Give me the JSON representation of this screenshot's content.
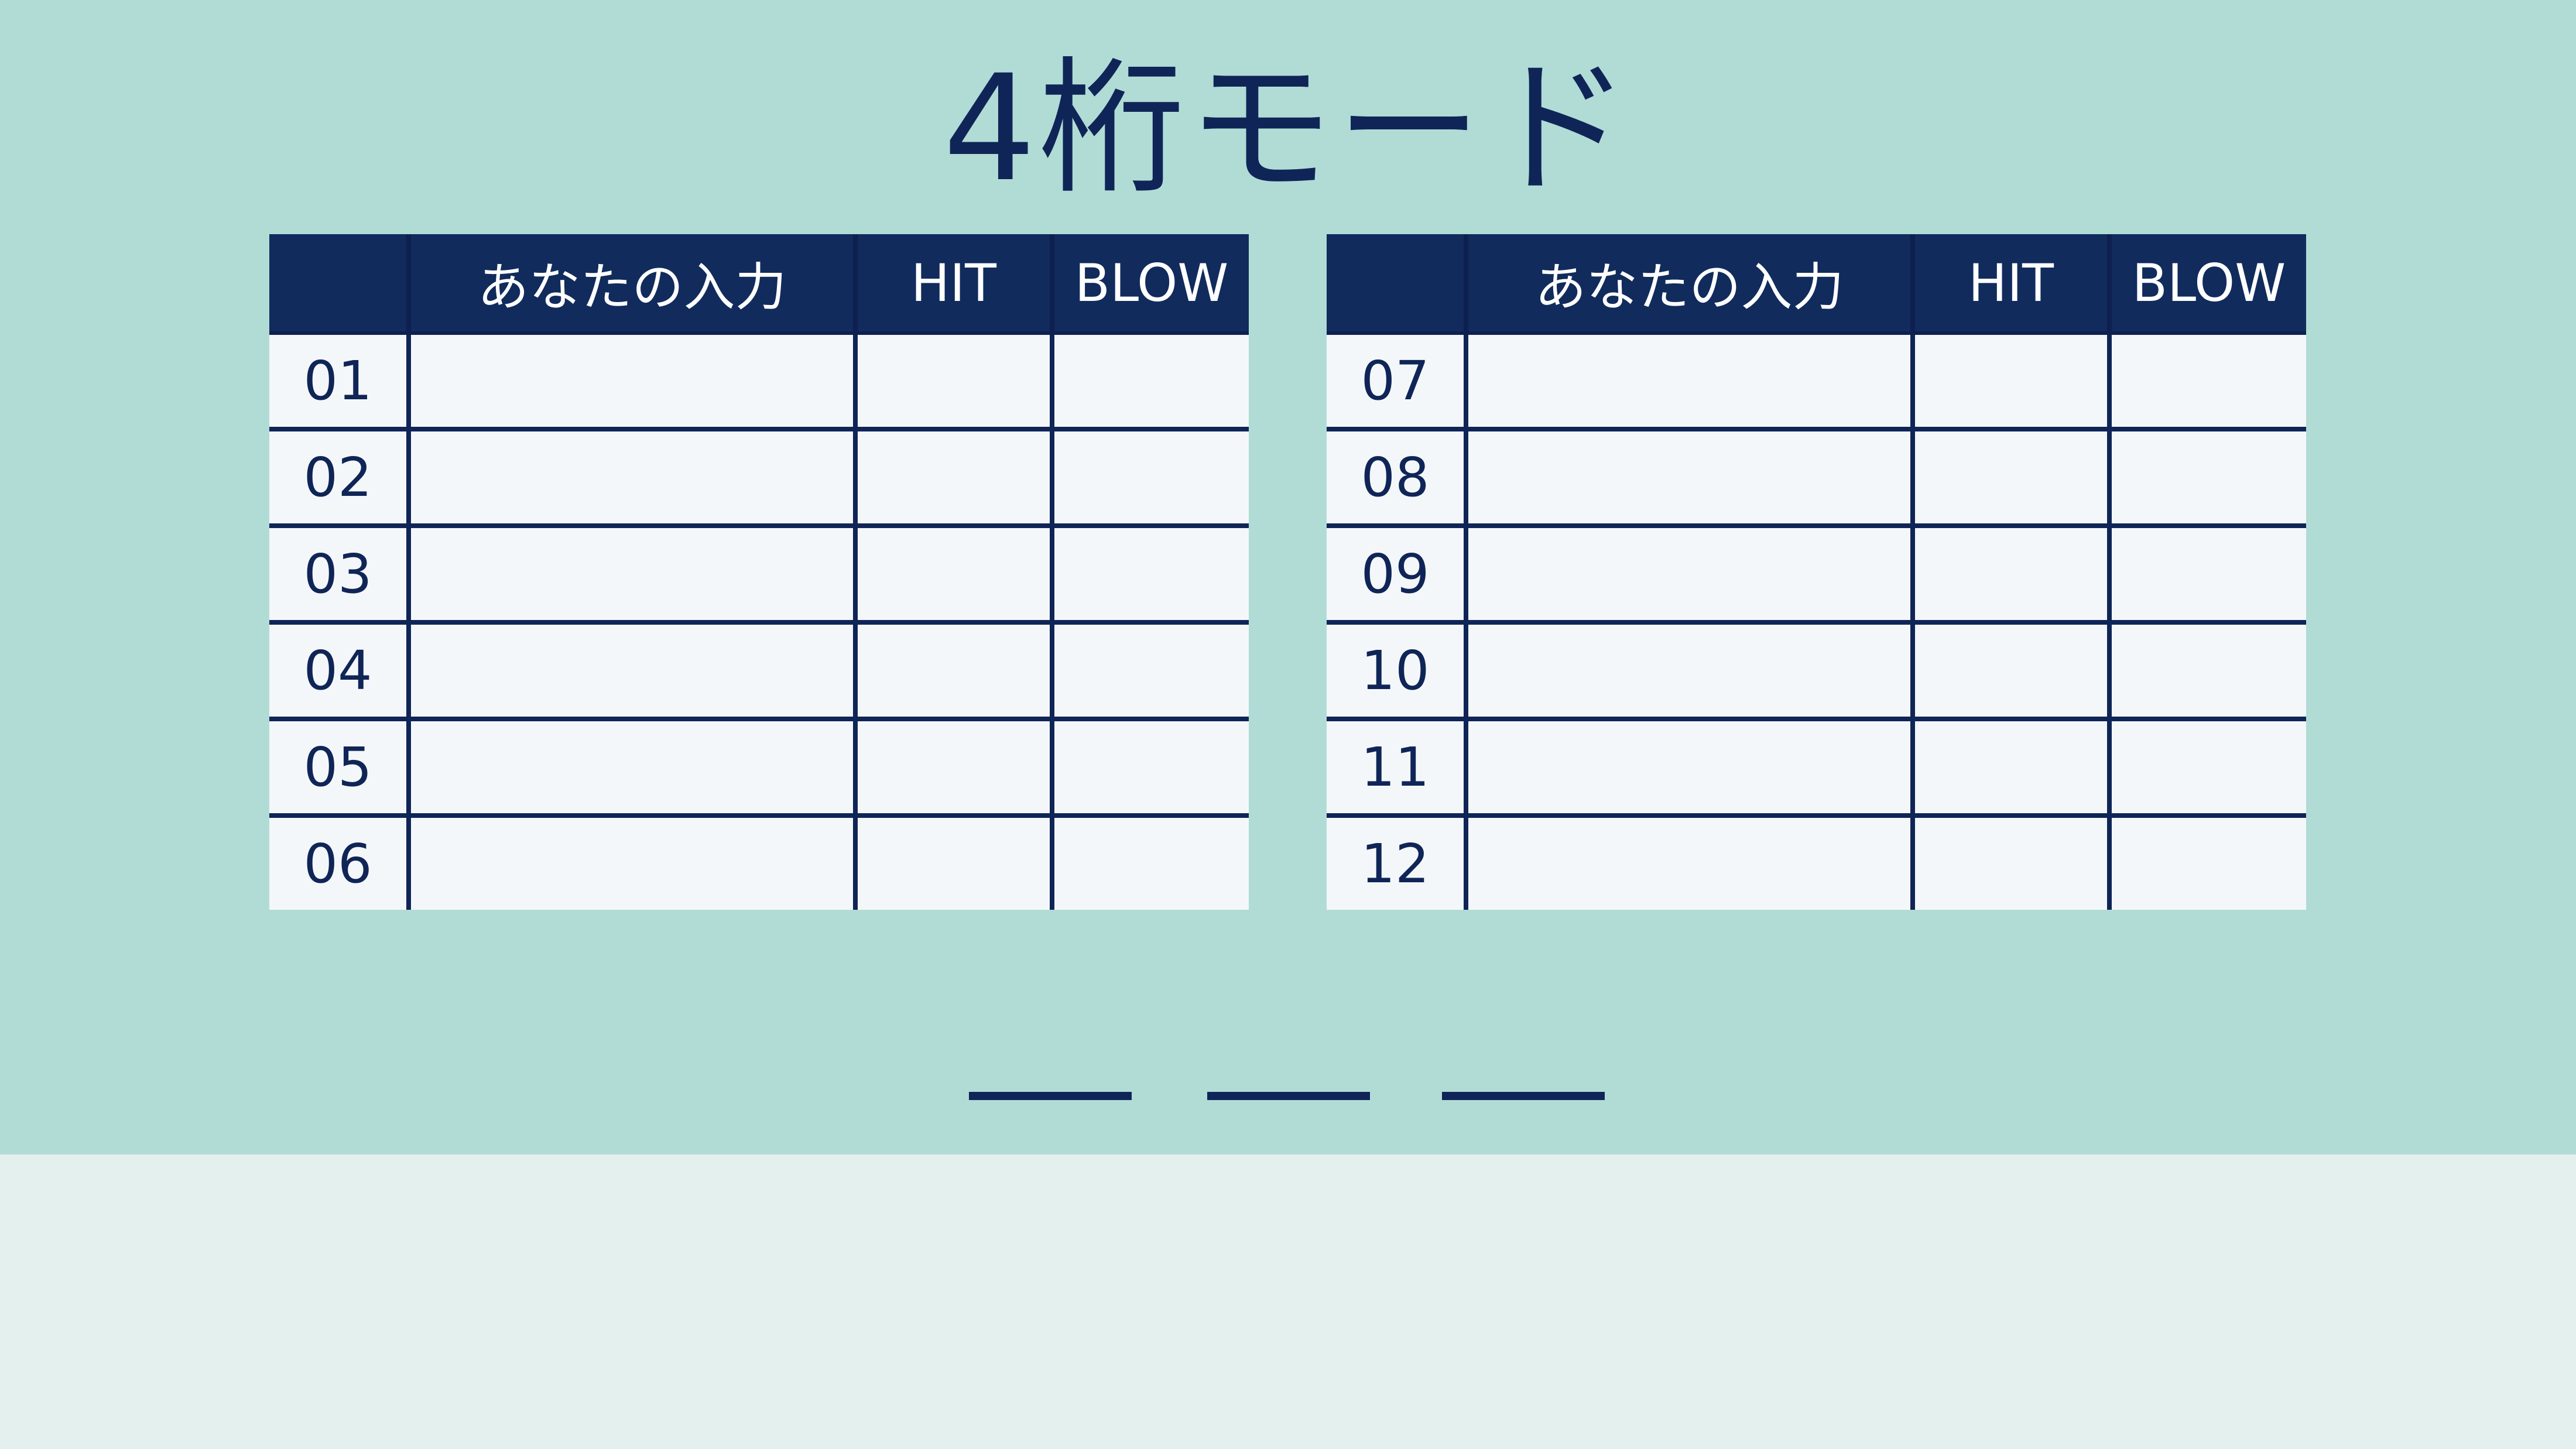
{
  "title": "4桁モード",
  "table_headers": {
    "number": "",
    "input": "あなたの入力",
    "hit": "HIT",
    "blow": "BLOW"
  },
  "left_table": {
    "rows": [
      {
        "number": "01",
        "input": "",
        "hit": "",
        "blow": ""
      },
      {
        "number": "02",
        "input": "",
        "hit": "",
        "blow": ""
      },
      {
        "number": "03",
        "input": "",
        "hit": "",
        "blow": ""
      },
      {
        "number": "04",
        "input": "",
        "hit": "",
        "blow": ""
      },
      {
        "number": "05",
        "input": "",
        "hit": "",
        "blow": ""
      },
      {
        "number": "06",
        "input": "",
        "hit": "",
        "blow": ""
      }
    ]
  },
  "right_table": {
    "rows": [
      {
        "number": "07",
        "input": "",
        "hit": "",
        "blow": ""
      },
      {
        "number": "08",
        "input": "",
        "hit": "",
        "blow": ""
      },
      {
        "number": "09",
        "input": "",
        "hit": "",
        "blow": ""
      },
      {
        "number": "10",
        "input": "",
        "hit": "",
        "blow": ""
      },
      {
        "number": "11",
        "input": "",
        "hit": "",
        "blow": ""
      },
      {
        "number": "12",
        "input": "",
        "hit": "",
        "blow": ""
      }
    ]
  },
  "answer_slots": [
    "",
    "",
    ""
  ],
  "colors": {
    "background_top": "#b1dcd6",
    "background_bottom": "#e3f0ee",
    "navy": "#0f2557",
    "header_fill": "#112b5c",
    "cell_fill": "#f4f7f9"
  }
}
